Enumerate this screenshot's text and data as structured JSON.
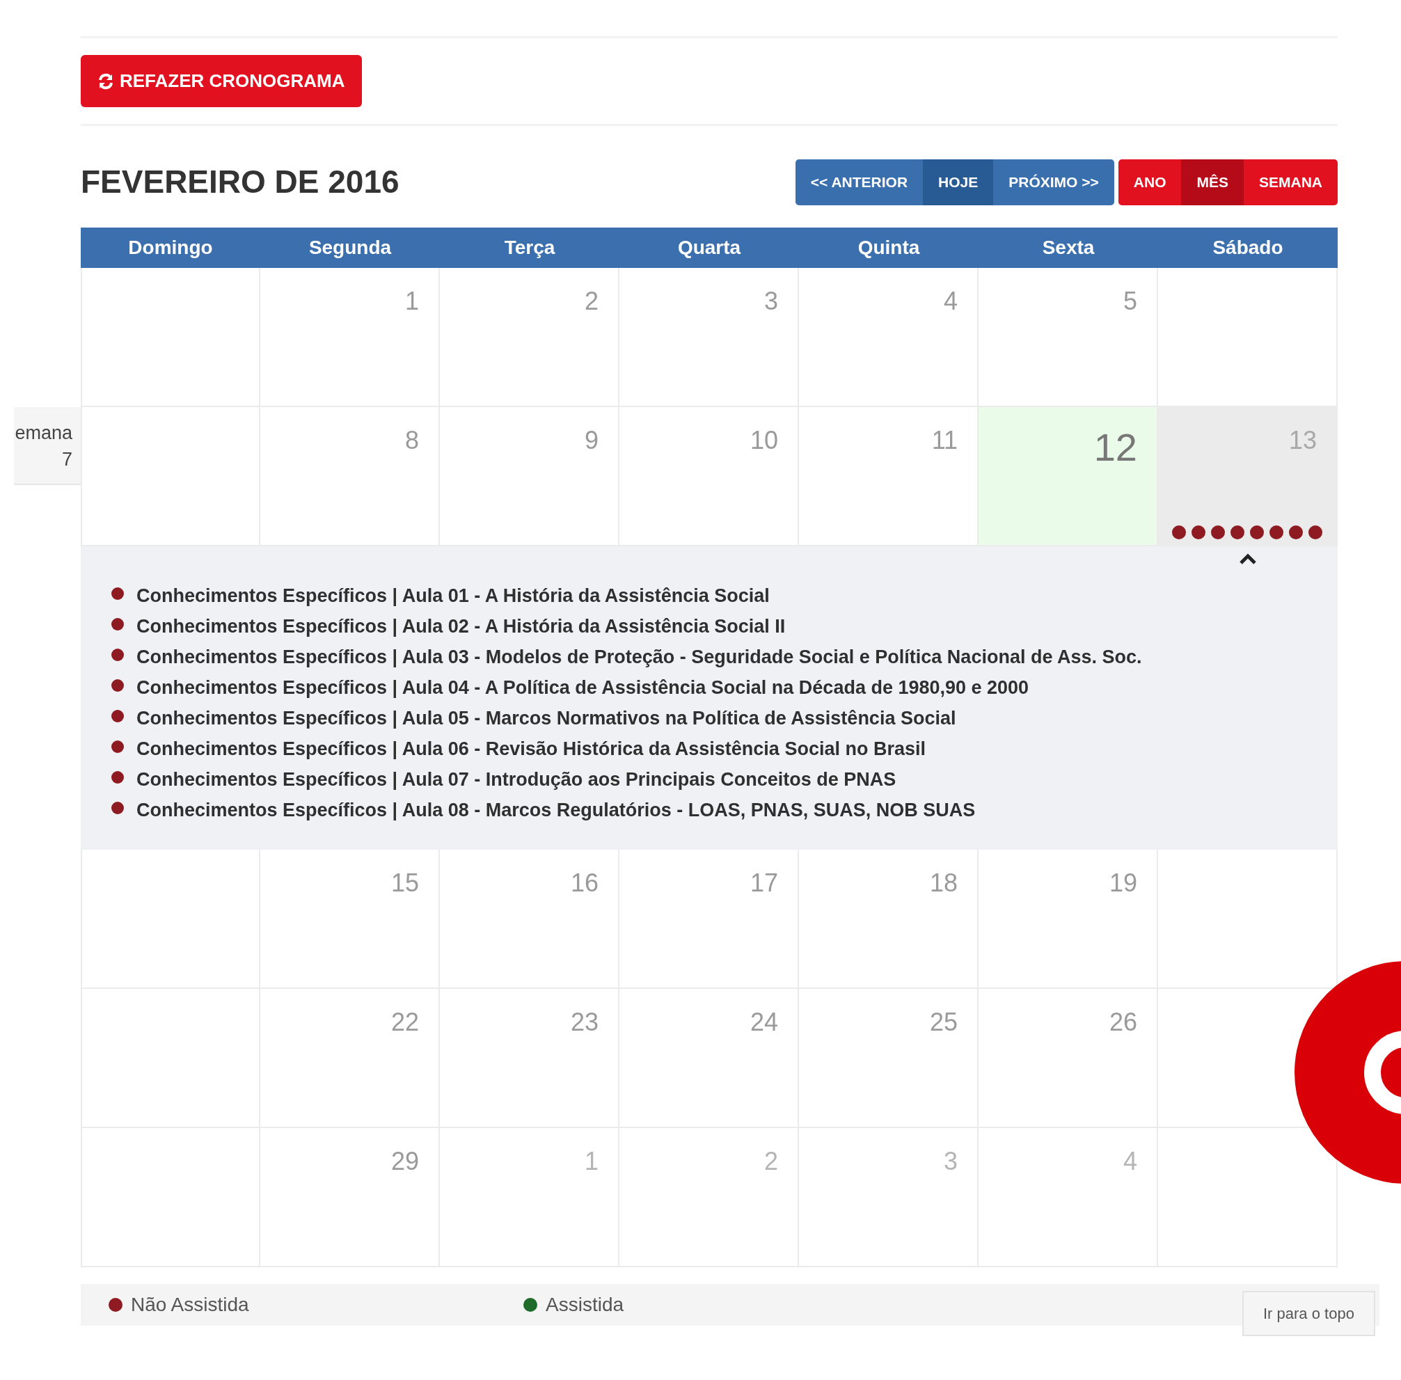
{
  "schedule_button": {
    "label": "REFAZER CRONOGRAMA"
  },
  "title": "FEVEREIRO DE 2016",
  "nav_buttons": [
    {
      "label": "<< ANTERIOR",
      "selected": false
    },
    {
      "label": "HOJE",
      "selected": true
    },
    {
      "label": "PRÓXIMO >>",
      "selected": false
    }
  ],
  "view_buttons": [
    {
      "label": "ANO",
      "selected": false
    },
    {
      "label": "MÊS",
      "selected": true
    },
    {
      "label": "SEMANA",
      "selected": false
    }
  ],
  "weekdays": [
    "Domingo",
    "Segunda",
    "Terça",
    "Quarta",
    "Quinta",
    "Sexta",
    "Sábado"
  ],
  "weeks": [
    {
      "days": [
        {
          "kind": "blank"
        },
        {
          "kind": "day",
          "number": "1",
          "other_month": false,
          "today": false,
          "selected": false
        },
        {
          "kind": "day",
          "number": "2",
          "other_month": false,
          "today": false,
          "selected": false
        },
        {
          "kind": "day",
          "number": "3",
          "other_month": false,
          "today": false,
          "selected": false
        },
        {
          "kind": "day",
          "number": "4",
          "other_month": false,
          "today": false,
          "selected": false
        },
        {
          "kind": "day",
          "number": "5",
          "other_month": false,
          "today": false,
          "selected": false
        },
        {
          "kind": "blank"
        }
      ]
    },
    {
      "week_label": [
        "emana",
        "7"
      ],
      "expanded": true,
      "days": [
        {
          "kind": "blank"
        },
        {
          "kind": "day",
          "number": "8",
          "other_month": false,
          "today": false,
          "selected": false
        },
        {
          "kind": "day",
          "number": "9",
          "other_month": false,
          "today": false,
          "selected": false
        },
        {
          "kind": "day",
          "number": "10",
          "other_month": false,
          "today": false,
          "selected": false
        },
        {
          "kind": "day",
          "number": "11",
          "other_month": false,
          "today": false,
          "selected": false
        },
        {
          "kind": "day",
          "number": "12",
          "other_month": false,
          "today": true,
          "selected": false
        },
        {
          "kind": "day",
          "number": "13",
          "other_month": false,
          "today": false,
          "selected": true,
          "events": [
            {
              "text": "Conhecimentos Específicos | Aula 01 - A História da Assistência Social",
              "watched": false
            },
            {
              "text": "Conhecimentos Específicos | Aula 02 - A História da Assistência Social II",
              "watched": false
            },
            {
              "text": "Conhecimentos Específicos | Aula 03 - Modelos de Proteção - Seguridade Social e Política Nacional de Ass. Soc.",
              "watched": false
            },
            {
              "text": "Conhecimentos Específicos | Aula 04 - A Política de Assistência Social na Década de 1980,90 e 2000",
              "watched": false
            },
            {
              "text": "Conhecimentos Específicos | Aula 05 - Marcos Normativos na Política de Assistência Social",
              "watched": false
            },
            {
              "text": "Conhecimentos Específicos | Aula 06 - Revisão Histórica da Assistência Social no Brasil",
              "watched": false
            },
            {
              "text": "Conhecimentos Específicos | Aula 07 - Introdução aos Principais Conceitos de PNAS",
              "watched": false
            },
            {
              "text": "Conhecimentos Específicos | Aula 08 - Marcos Regulatórios - LOAS, PNAS, SUAS, NOB SUAS",
              "watched": false
            }
          ]
        }
      ]
    },
    {
      "days": [
        {
          "kind": "blank"
        },
        {
          "kind": "day",
          "number": "15",
          "other_month": false,
          "today": false,
          "selected": false
        },
        {
          "kind": "day",
          "number": "16",
          "other_month": false,
          "today": false,
          "selected": false
        },
        {
          "kind": "day",
          "number": "17",
          "other_month": false,
          "today": false,
          "selected": false
        },
        {
          "kind": "day",
          "number": "18",
          "other_month": false,
          "today": false,
          "selected": false
        },
        {
          "kind": "day",
          "number": "19",
          "other_month": false,
          "today": false,
          "selected": false
        },
        {
          "kind": "blank"
        }
      ]
    },
    {
      "days": [
        {
          "kind": "blank"
        },
        {
          "kind": "day",
          "number": "22",
          "other_month": false,
          "today": false,
          "selected": false
        },
        {
          "kind": "day",
          "number": "23",
          "other_month": false,
          "today": false,
          "selected": false
        },
        {
          "kind": "day",
          "number": "24",
          "other_month": false,
          "today": false,
          "selected": false
        },
        {
          "kind": "day",
          "number": "25",
          "other_month": false,
          "today": false,
          "selected": false
        },
        {
          "kind": "day",
          "number": "26",
          "other_month": false,
          "today": false,
          "selected": false
        },
        {
          "kind": "blank"
        }
      ]
    },
    {
      "days": [
        {
          "kind": "blank"
        },
        {
          "kind": "day",
          "number": "29",
          "other_month": false,
          "today": false,
          "selected": false
        },
        {
          "kind": "day",
          "number": "1",
          "other_month": true,
          "today": false,
          "selected": false
        },
        {
          "kind": "day",
          "number": "2",
          "other_month": true,
          "today": false,
          "selected": false
        },
        {
          "kind": "day",
          "number": "3",
          "other_month": true,
          "today": false,
          "selected": false
        },
        {
          "kind": "day",
          "number": "4",
          "other_month": true,
          "today": false,
          "selected": false
        },
        {
          "kind": "blank"
        }
      ]
    }
  ],
  "legend": [
    {
      "label": "Não Assistida",
      "color": "#8e1b22"
    },
    {
      "label": "Assistida",
      "color": "#1e6b2a"
    }
  ],
  "top_button": {
    "label": "Ir para o topo"
  }
}
